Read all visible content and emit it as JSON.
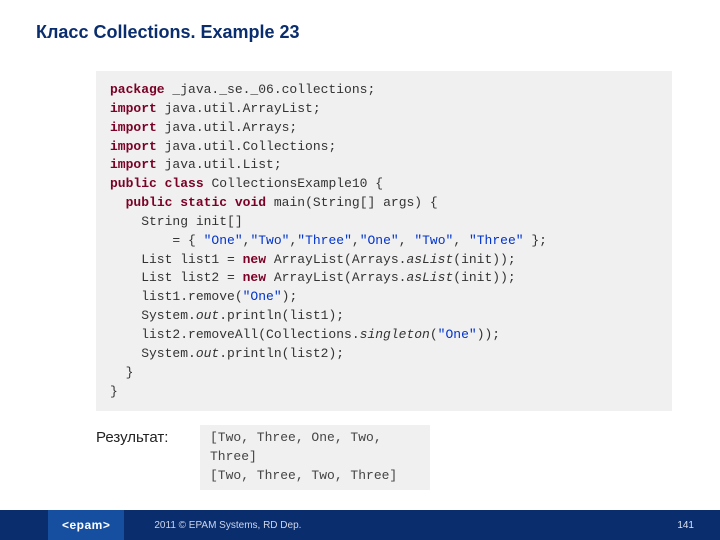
{
  "title": "Класс  Collections. Example 23",
  "code": {
    "kw_package": "package",
    "pkg_name": " _java._se._06.collections;",
    "kw_import": "import",
    "imp1": " java.util.ArrayList;",
    "imp2": " java.util.Arrays;",
    "imp3": " java.util.Collections;",
    "imp4": " java.util.List;",
    "kw_public": "public",
    "kw_class": "class",
    "class_name": " CollectionsExample10 {",
    "kw_static": "static",
    "kw_void": "void",
    "main_sig": " main(String[] args) {",
    "line_init_decl": "    String init[]",
    "line_init_eq": "        = { ",
    "s1": "\"One\"",
    "c1": ",",
    "s2": "\"Two\"",
    "c2": ",",
    "s3": "\"Three\"",
    "c3": ",",
    "s4": "\"One\"",
    "c4": ", ",
    "s5": "\"Two\"",
    "c5": ", ",
    "s6": "\"Three\"",
    "arr_close": " };",
    "list1_a": "    List list1 = ",
    "kw_new": "new",
    "list_b": " ArrayList(Arrays.",
    "asList": "asList",
    "list_c": "(init));",
    "list2_a": "    List list2 = ",
    "rem1_a": "    list1.remove(",
    "s_one": "\"One\"",
    "rem1_b": ");",
    "print1_a": "    System.",
    "out": "out",
    "print1_b": ".println(list1);",
    "rem2_a": "    list2.removeAll(Collections.",
    "singleton": "singleton",
    "rem2_b": "(",
    "rem2_c": "));",
    "print2_b": ".println(list2);",
    "close_method": "  }",
    "close_class": "}"
  },
  "result_label": "Результат:",
  "result_output": "[Two, Three, One, Two, Three]\n[Two, Three, Two, Three]",
  "footer": {
    "logo": "<epam>",
    "copyright": "2011 © EPAM Systems, RD Dep.",
    "pagenum": "141"
  }
}
